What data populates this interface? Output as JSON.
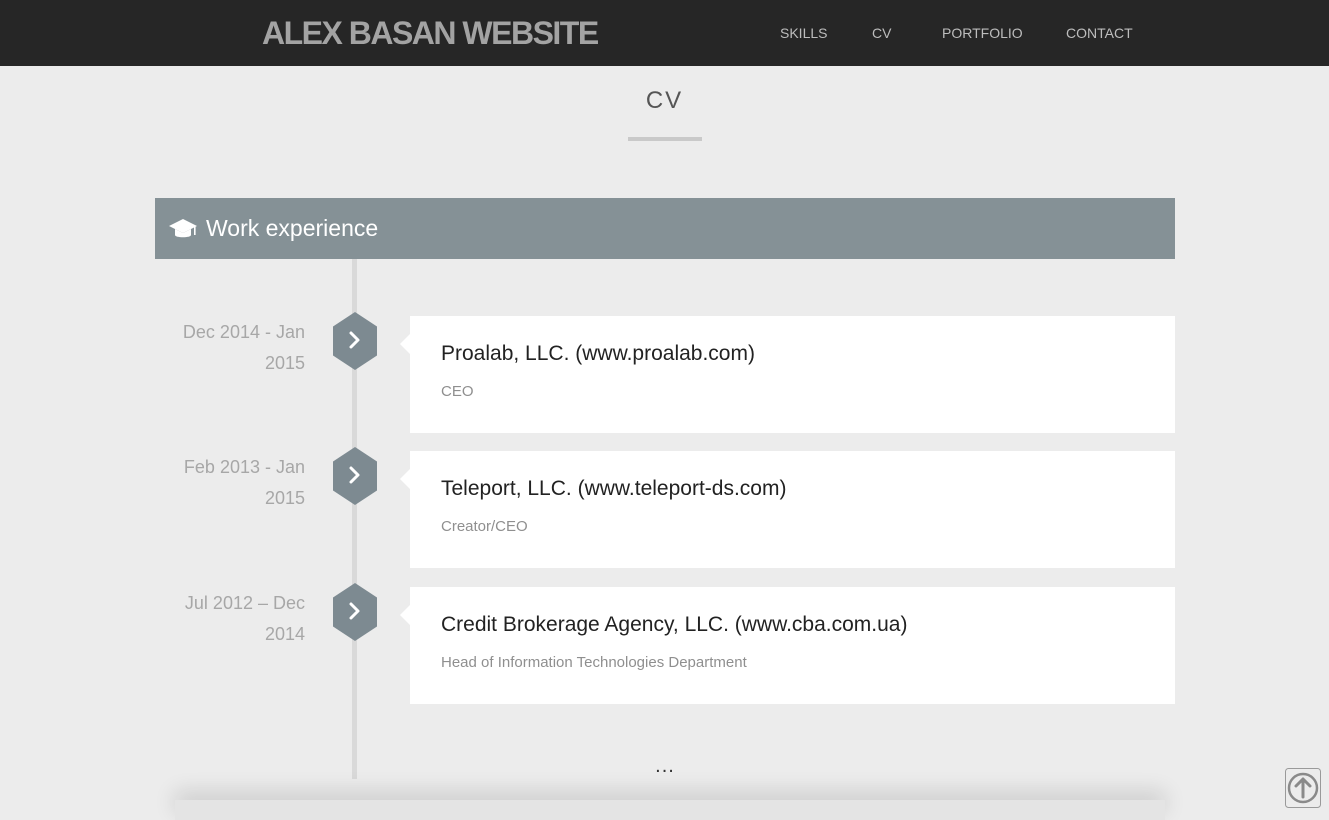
{
  "header": {
    "brand": "ALEX BASAN WEBSITE",
    "nav": [
      "SKILLS",
      "CV",
      "PORTFOLIO",
      "CONTACT"
    ]
  },
  "section": {
    "title": "CV"
  },
  "work_experience": {
    "heading": "Work experience",
    "icon": "graduation-cap-icon",
    "entries": [
      {
        "date_line1": "Dec 2014 - Jan",
        "date_line2": "2015",
        "company": "Proalab, LLC. (www.proalab.com)",
        "role": "CEO"
      },
      {
        "date_line1": "Feb 2013 - Jan 2015",
        "date_line2": "",
        "company": "Teleport, LLC. (www.teleport-ds.com)",
        "role": "Creator/CEO"
      },
      {
        "date_line1": "Jul 2012 – Dec",
        "date_line2": "2014",
        "company": "Credit Brokerage Agency, LLC. (www.cba.com.ua)",
        "role": "Head of Information Technologies Department"
      }
    ],
    "more": "..."
  },
  "colors": {
    "topbar": "#262626",
    "panel_header": "#859196",
    "background": "#ececec",
    "hex_marker": "#7d8a91"
  },
  "icons": {
    "marker": "chevron-right-icon",
    "scroll_top": "arrow-up-circle-icon"
  }
}
